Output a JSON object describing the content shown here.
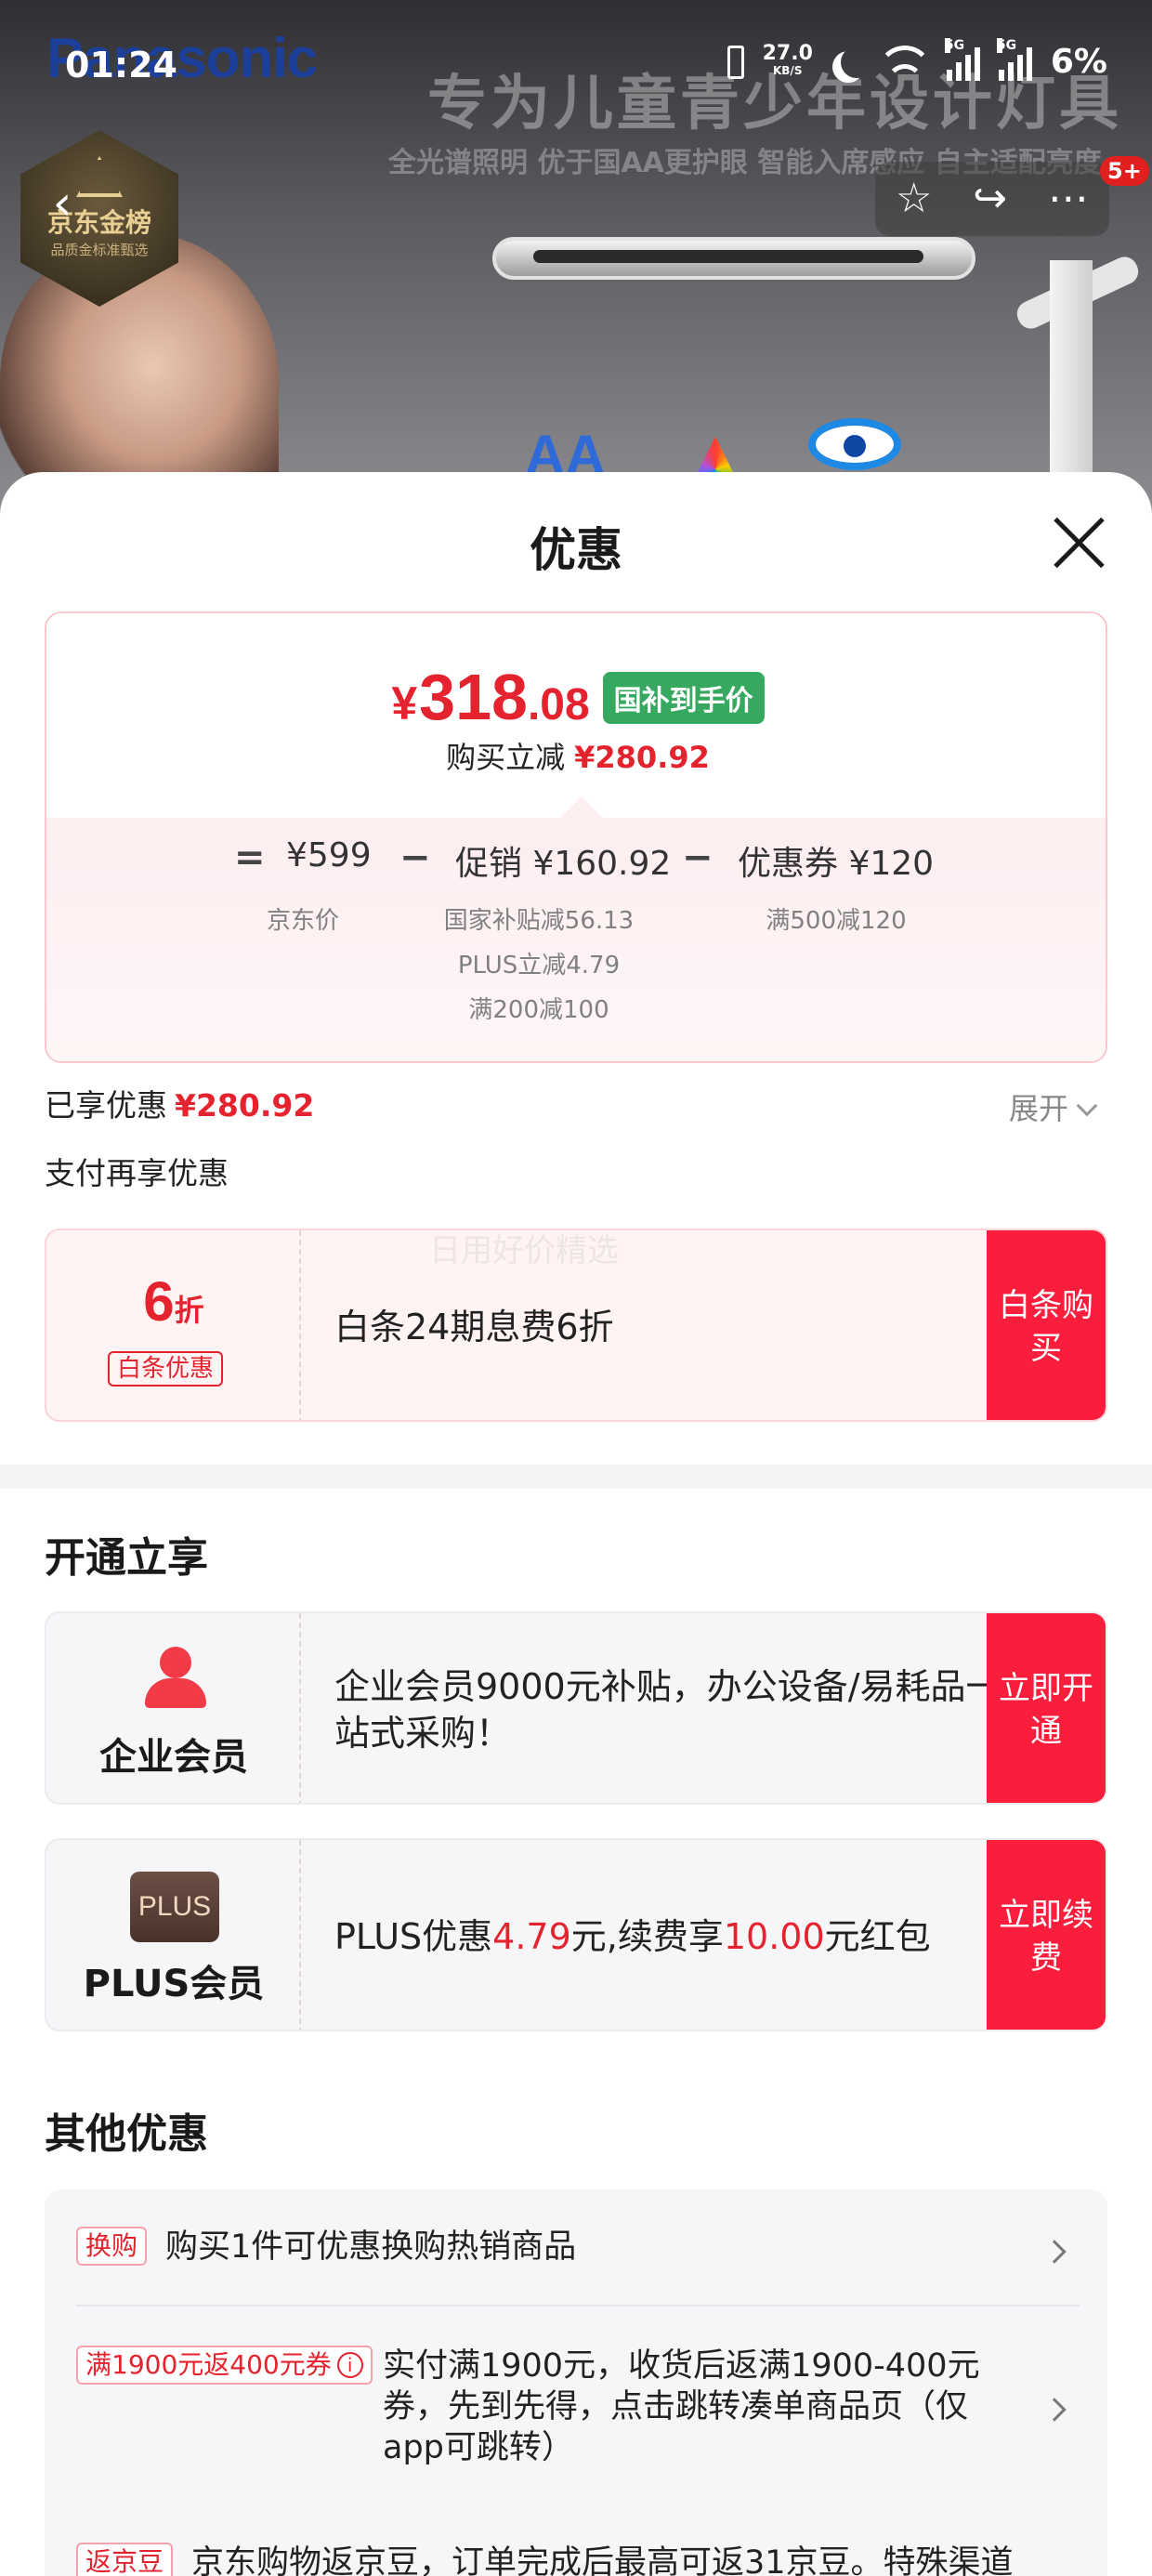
{
  "status_bar": {
    "time": "01:24",
    "net_speed": "27.0",
    "net_unit": "KB/S",
    "signal1_label": "5G",
    "signal2_label": "5G",
    "battery": "6%"
  },
  "banner": {
    "brand": "Panasonic",
    "headline": "专为儿童青少年设计灯具",
    "subline": "全光谱照明 优于国AA更护眼 智能入席感应 自主适配亮度",
    "badge_title": "京东金榜",
    "badge_sub": "品质金标准甄选",
    "aa_icon_text": "AA",
    "message_count": "5+"
  },
  "sheet": {
    "title": "优惠",
    "price": {
      "currency": "¥",
      "integer": "318",
      "decimal": ".08",
      "tag": "国补到手价",
      "reduce_label": "购买立减",
      "reduce_value": "¥280.92"
    },
    "formula": {
      "eq": "=",
      "minus": "−",
      "jd_price": "¥599",
      "jd_price_label": "京东价",
      "promo": "促销 ¥160.92",
      "promo_details": [
        "国家补贴减56.13",
        "PLUS立减4.79",
        "满200减100"
      ],
      "coupon": "优惠券 ¥120",
      "coupon_detail": "满500减120"
    },
    "enjoyed_label": "已享优惠",
    "enjoyed_value": "¥280.92",
    "expand_label": "展开",
    "pay_title": "支付再享优惠",
    "baitiao": {
      "big_num": "6",
      "big_unit": "折",
      "tag": "白条优惠",
      "text": "白条24期息费6折",
      "cta": "白条购买"
    },
    "watermark": "日用好价精选",
    "open_title": "开通立享",
    "enterprise": {
      "name": "企业会员",
      "text": "企业会员9000元补贴，办公设备/易耗品一站式采购！",
      "cta": "立即开通",
      "icon": "person-icon"
    },
    "plus": {
      "logo": "PLUS",
      "name": "PLUS会员",
      "text_a": "PLUS优惠",
      "amount1": "4.79",
      "text_b": "元,续费享",
      "amount2": "10.00",
      "text_c": "元红包",
      "cta": "立即续费"
    },
    "other_title": "其他优惠",
    "other": [
      {
        "tag": "换购",
        "text": "购买1件可优惠换购热销商品"
      },
      {
        "tag": "满1900元返400元券",
        "text": "实付满1900元，收货后返满1900-400元券，先到先得，点击跳转凑单商品页（仅app可跳转）"
      },
      {
        "tag": "返京豆",
        "text": "京东购物返京豆，订单完成后最高可返31京豆。特殊渠道"
      }
    ],
    "info_icon": "i"
  }
}
